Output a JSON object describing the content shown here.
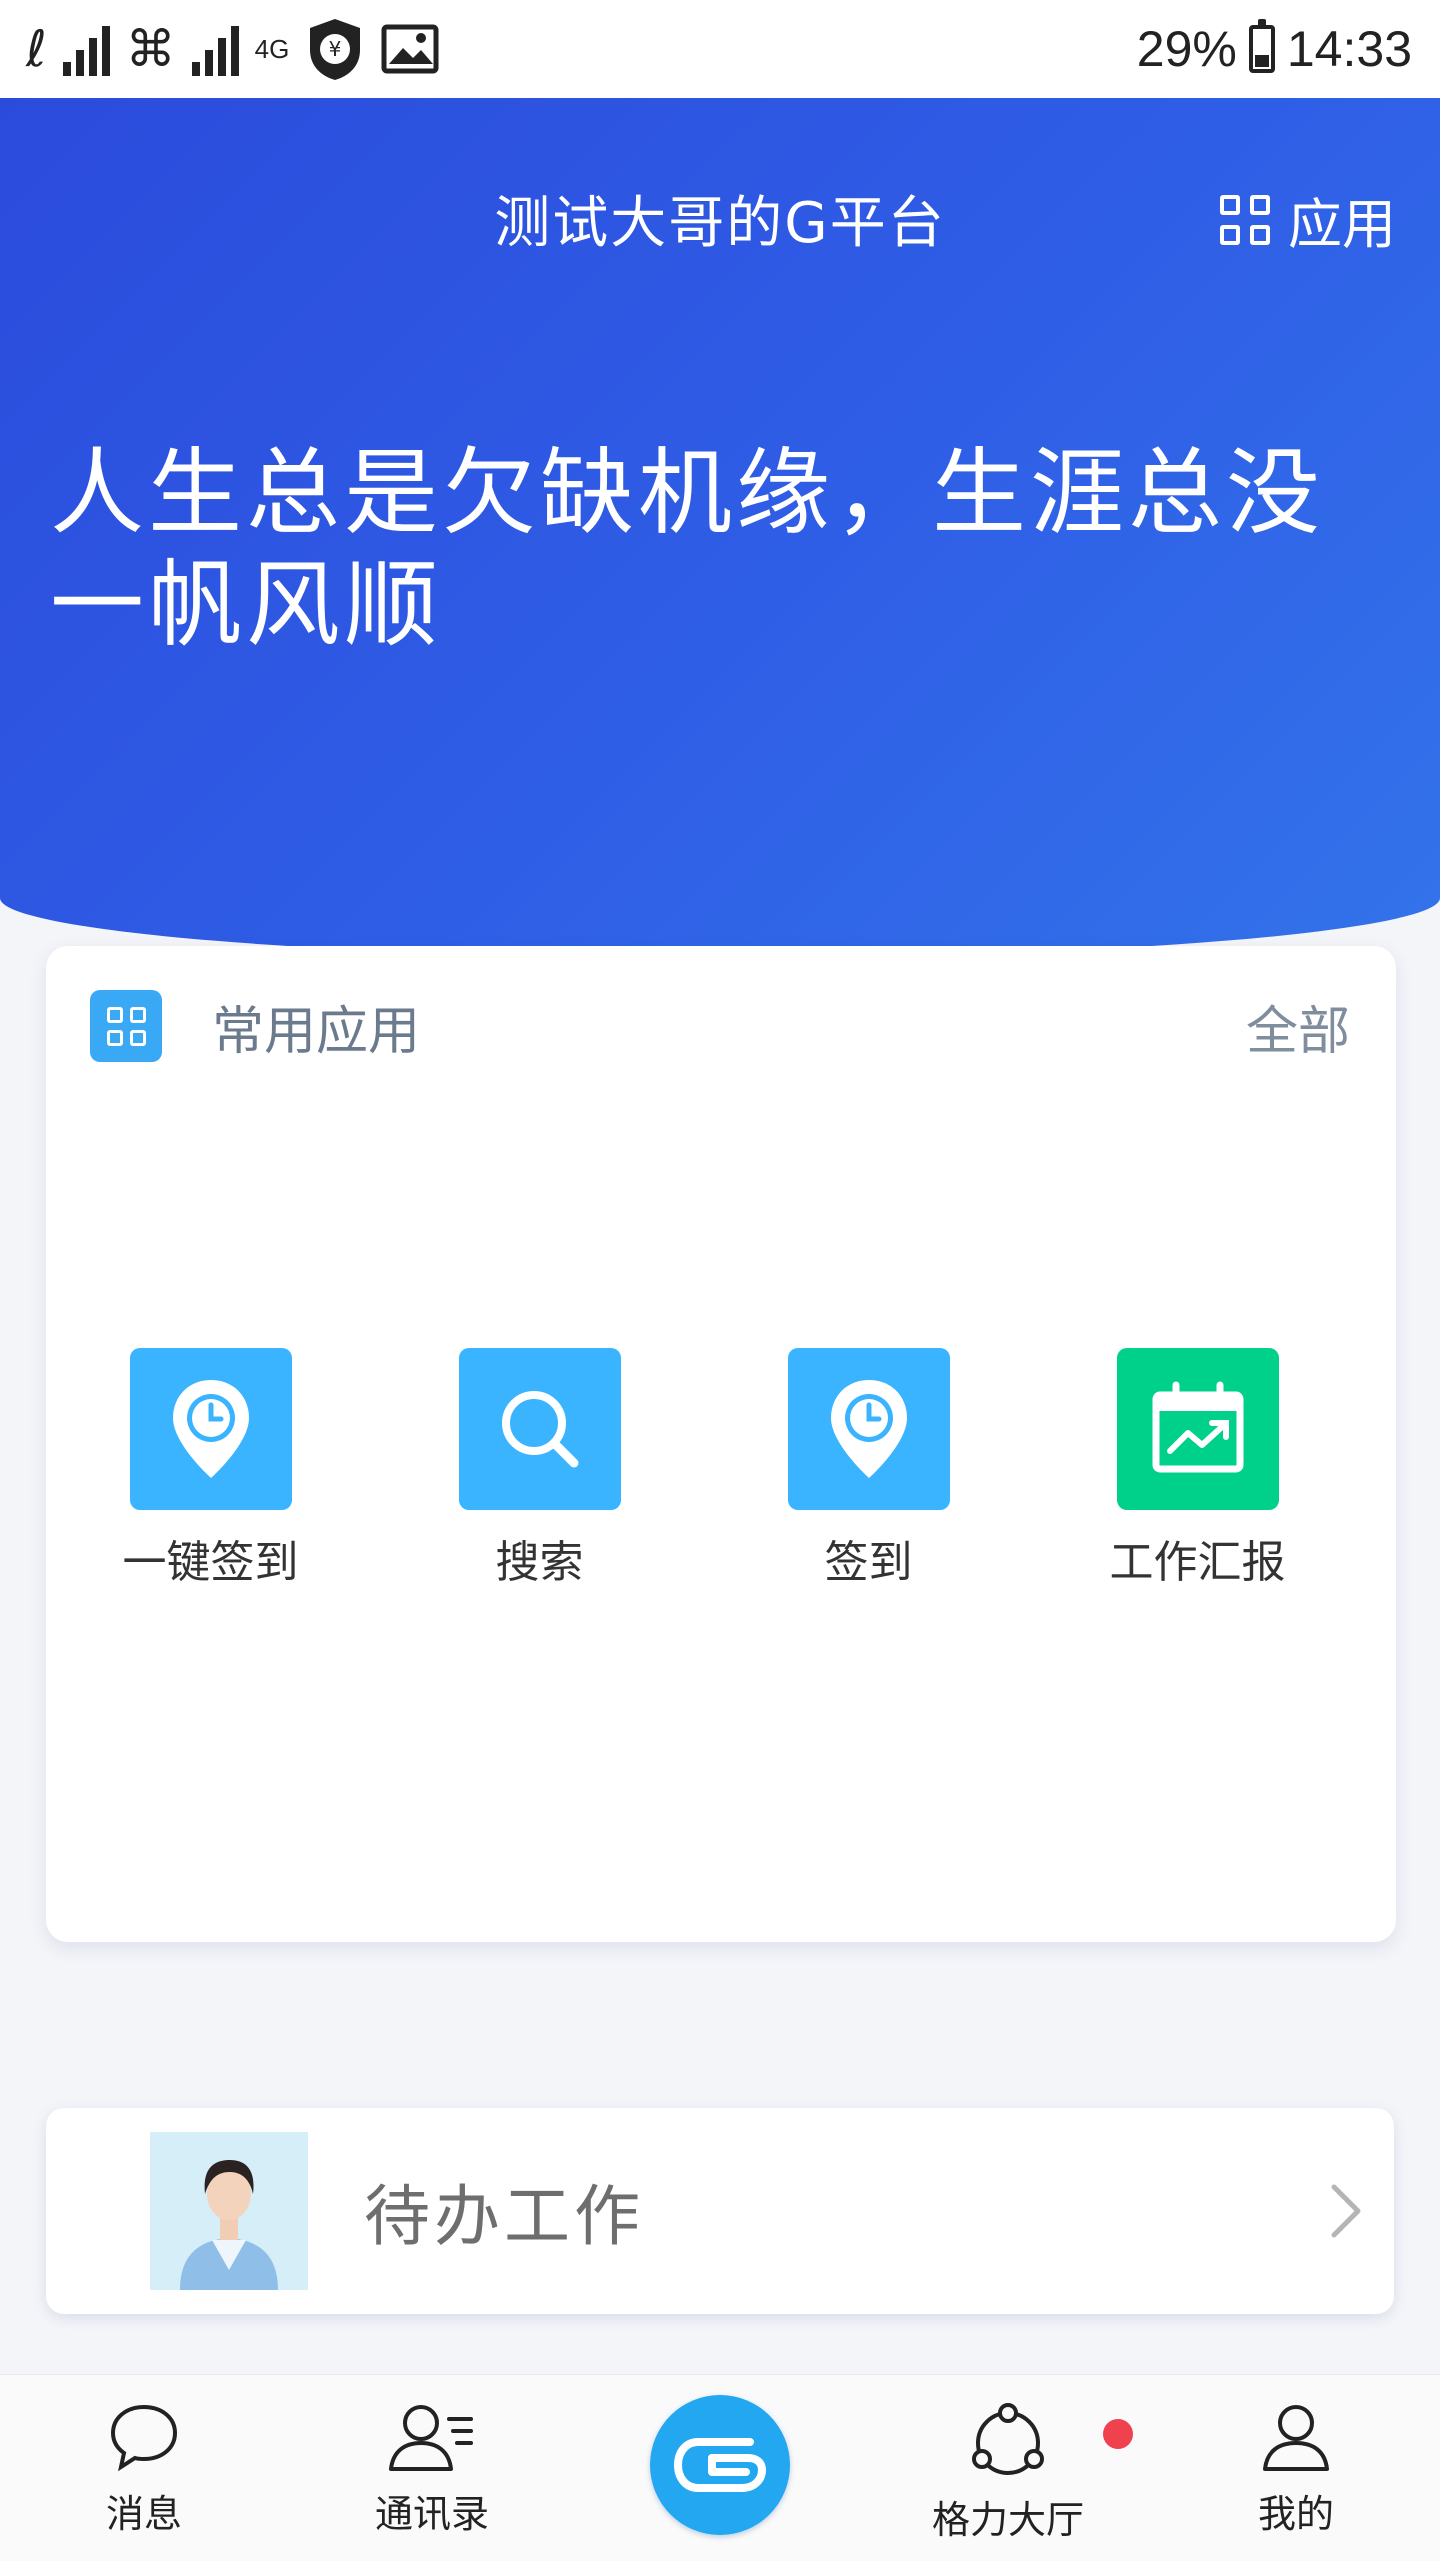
{
  "status_bar": {
    "network_type": "4G",
    "battery_percent": "29%",
    "battery_level": 0.29,
    "time": "14:33"
  },
  "header": {
    "title": "测试大哥的G平台",
    "apps_label": "应用"
  },
  "hero": {
    "motto": "人生总是欠缺机缘，生涯总没一帆风顺"
  },
  "common_apps": {
    "title": "常用应用",
    "all_label": "全部",
    "items": [
      {
        "label": "一键签到",
        "icon": "location-clock-icon",
        "color": "#3ab4ff"
      },
      {
        "label": "搜索",
        "icon": "search-icon",
        "color": "#3ab4ff"
      },
      {
        "label": "签到",
        "icon": "location-clock-icon",
        "color": "#3ab4ff"
      },
      {
        "label": "工作汇报",
        "icon": "calendar-chart-icon",
        "color": "#00d18a"
      }
    ]
  },
  "todo": {
    "label": "待办工作"
  },
  "tabbar": {
    "items": [
      {
        "label": "消息",
        "icon": "chat-bubble-icon"
      },
      {
        "label": "通讯录",
        "icon": "contacts-icon"
      },
      {
        "label": "",
        "icon": "g-logo-icon"
      },
      {
        "label": "格力大厅",
        "icon": "hall-icon",
        "badge": true
      },
      {
        "label": "我的",
        "icon": "user-icon"
      }
    ]
  },
  "colors": {
    "brand_blue": "#2f5ee6",
    "app_blue": "#3ab4ff",
    "app_green": "#00d18a",
    "badge_red": "#f0414e"
  }
}
